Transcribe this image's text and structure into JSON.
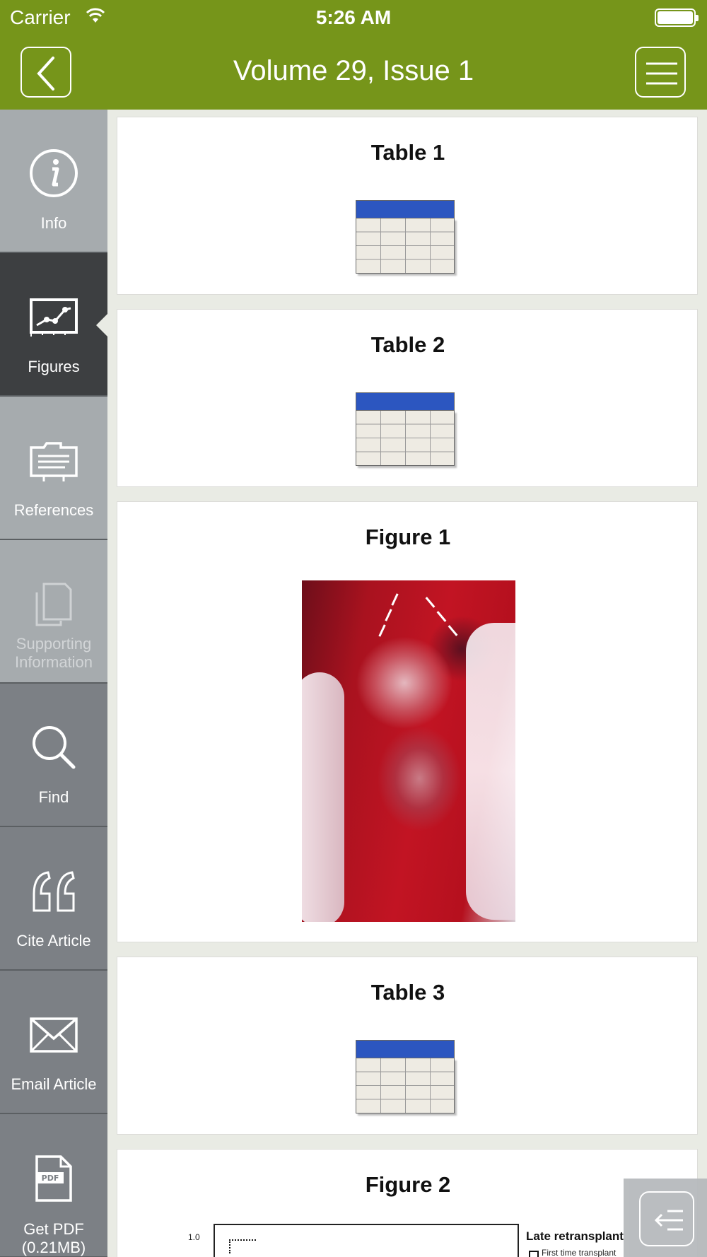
{
  "status_bar": {
    "carrier": "Carrier",
    "time": "5:26 AM"
  },
  "header": {
    "title": "Volume 29, Issue 1"
  },
  "sidebar": {
    "items": [
      {
        "label": "Info",
        "icon": "info-icon"
      },
      {
        "label": "Figures",
        "icon": "chart-icon",
        "active": true
      },
      {
        "label": "References",
        "icon": "folder-icon"
      },
      {
        "label": "Supporting Information",
        "icon": "copy-icon",
        "disabled": true
      },
      {
        "label": "Find",
        "icon": "search-icon"
      },
      {
        "label": "Cite Article",
        "icon": "quote-icon"
      },
      {
        "label": "Email Article",
        "icon": "envelope-icon"
      },
      {
        "label": "Get PDF (0.21MB)",
        "icon": "pdf-icon"
      }
    ]
  },
  "content": {
    "cards": [
      {
        "title": "Table 1",
        "type": "table"
      },
      {
        "title": "Table 2",
        "type": "table"
      },
      {
        "title": "Figure 1",
        "type": "image"
      },
      {
        "title": "Table 3",
        "type": "table"
      },
      {
        "title": "Figure 2",
        "type": "chart"
      }
    ],
    "figure2_preview": {
      "tick": "1.0",
      "legend_title": "Late retransplant",
      "legend_item": "First time transplant"
    }
  },
  "colors": {
    "header": "#76951a",
    "sidebar_active": "#3d3f41",
    "sidebar_light": "#a6abae",
    "sidebar_dark": "#7c8085",
    "table_header": "#2c56c0"
  }
}
